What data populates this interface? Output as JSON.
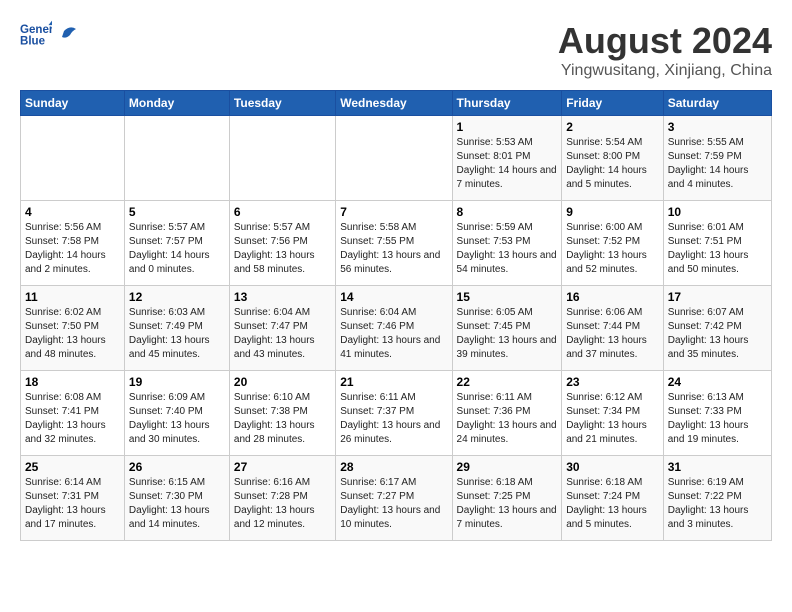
{
  "logo": {
    "line1": "General",
    "line2": "Blue"
  },
  "title": "August 2024",
  "subtitle": "Yingwusitang, Xinjiang, China",
  "days_header": [
    "Sunday",
    "Monday",
    "Tuesday",
    "Wednesday",
    "Thursday",
    "Friday",
    "Saturday"
  ],
  "weeks": [
    [
      {
        "day": "",
        "sunrise": "",
        "sunset": "",
        "daylight": ""
      },
      {
        "day": "",
        "sunrise": "",
        "sunset": "",
        "daylight": ""
      },
      {
        "day": "",
        "sunrise": "",
        "sunset": "",
        "daylight": ""
      },
      {
        "day": "",
        "sunrise": "",
        "sunset": "",
        "daylight": ""
      },
      {
        "day": "1",
        "sunrise": "Sunrise: 5:53 AM",
        "sunset": "Sunset: 8:01 PM",
        "daylight": "Daylight: 14 hours and 7 minutes."
      },
      {
        "day": "2",
        "sunrise": "Sunrise: 5:54 AM",
        "sunset": "Sunset: 8:00 PM",
        "daylight": "Daylight: 14 hours and 5 minutes."
      },
      {
        "day": "3",
        "sunrise": "Sunrise: 5:55 AM",
        "sunset": "Sunset: 7:59 PM",
        "daylight": "Daylight: 14 hours and 4 minutes."
      }
    ],
    [
      {
        "day": "4",
        "sunrise": "Sunrise: 5:56 AM",
        "sunset": "Sunset: 7:58 PM",
        "daylight": "Daylight: 14 hours and 2 minutes."
      },
      {
        "day": "5",
        "sunrise": "Sunrise: 5:57 AM",
        "sunset": "Sunset: 7:57 PM",
        "daylight": "Daylight: 14 hours and 0 minutes."
      },
      {
        "day": "6",
        "sunrise": "Sunrise: 5:57 AM",
        "sunset": "Sunset: 7:56 PM",
        "daylight": "Daylight: 13 hours and 58 minutes."
      },
      {
        "day": "7",
        "sunrise": "Sunrise: 5:58 AM",
        "sunset": "Sunset: 7:55 PM",
        "daylight": "Daylight: 13 hours and 56 minutes."
      },
      {
        "day": "8",
        "sunrise": "Sunrise: 5:59 AM",
        "sunset": "Sunset: 7:53 PM",
        "daylight": "Daylight: 13 hours and 54 minutes."
      },
      {
        "day": "9",
        "sunrise": "Sunrise: 6:00 AM",
        "sunset": "Sunset: 7:52 PM",
        "daylight": "Daylight: 13 hours and 52 minutes."
      },
      {
        "day": "10",
        "sunrise": "Sunrise: 6:01 AM",
        "sunset": "Sunset: 7:51 PM",
        "daylight": "Daylight: 13 hours and 50 minutes."
      }
    ],
    [
      {
        "day": "11",
        "sunrise": "Sunrise: 6:02 AM",
        "sunset": "Sunset: 7:50 PM",
        "daylight": "Daylight: 13 hours and 48 minutes."
      },
      {
        "day": "12",
        "sunrise": "Sunrise: 6:03 AM",
        "sunset": "Sunset: 7:49 PM",
        "daylight": "Daylight: 13 hours and 45 minutes."
      },
      {
        "day": "13",
        "sunrise": "Sunrise: 6:04 AM",
        "sunset": "Sunset: 7:47 PM",
        "daylight": "Daylight: 13 hours and 43 minutes."
      },
      {
        "day": "14",
        "sunrise": "Sunrise: 6:04 AM",
        "sunset": "Sunset: 7:46 PM",
        "daylight": "Daylight: 13 hours and 41 minutes."
      },
      {
        "day": "15",
        "sunrise": "Sunrise: 6:05 AM",
        "sunset": "Sunset: 7:45 PM",
        "daylight": "Daylight: 13 hours and 39 minutes."
      },
      {
        "day": "16",
        "sunrise": "Sunrise: 6:06 AM",
        "sunset": "Sunset: 7:44 PM",
        "daylight": "Daylight: 13 hours and 37 minutes."
      },
      {
        "day": "17",
        "sunrise": "Sunrise: 6:07 AM",
        "sunset": "Sunset: 7:42 PM",
        "daylight": "Daylight: 13 hours and 35 minutes."
      }
    ],
    [
      {
        "day": "18",
        "sunrise": "Sunrise: 6:08 AM",
        "sunset": "Sunset: 7:41 PM",
        "daylight": "Daylight: 13 hours and 32 minutes."
      },
      {
        "day": "19",
        "sunrise": "Sunrise: 6:09 AM",
        "sunset": "Sunset: 7:40 PM",
        "daylight": "Daylight: 13 hours and 30 minutes."
      },
      {
        "day": "20",
        "sunrise": "Sunrise: 6:10 AM",
        "sunset": "Sunset: 7:38 PM",
        "daylight": "Daylight: 13 hours and 28 minutes."
      },
      {
        "day": "21",
        "sunrise": "Sunrise: 6:11 AM",
        "sunset": "Sunset: 7:37 PM",
        "daylight": "Daylight: 13 hours and 26 minutes."
      },
      {
        "day": "22",
        "sunrise": "Sunrise: 6:11 AM",
        "sunset": "Sunset: 7:36 PM",
        "daylight": "Daylight: 13 hours and 24 minutes."
      },
      {
        "day": "23",
        "sunrise": "Sunrise: 6:12 AM",
        "sunset": "Sunset: 7:34 PM",
        "daylight": "Daylight: 13 hours and 21 minutes."
      },
      {
        "day": "24",
        "sunrise": "Sunrise: 6:13 AM",
        "sunset": "Sunset: 7:33 PM",
        "daylight": "Daylight: 13 hours and 19 minutes."
      }
    ],
    [
      {
        "day": "25",
        "sunrise": "Sunrise: 6:14 AM",
        "sunset": "Sunset: 7:31 PM",
        "daylight": "Daylight: 13 hours and 17 minutes."
      },
      {
        "day": "26",
        "sunrise": "Sunrise: 6:15 AM",
        "sunset": "Sunset: 7:30 PM",
        "daylight": "Daylight: 13 hours and 14 minutes."
      },
      {
        "day": "27",
        "sunrise": "Sunrise: 6:16 AM",
        "sunset": "Sunset: 7:28 PM",
        "daylight": "Daylight: 13 hours and 12 minutes."
      },
      {
        "day": "28",
        "sunrise": "Sunrise: 6:17 AM",
        "sunset": "Sunset: 7:27 PM",
        "daylight": "Daylight: 13 hours and 10 minutes."
      },
      {
        "day": "29",
        "sunrise": "Sunrise: 6:18 AM",
        "sunset": "Sunset: 7:25 PM",
        "daylight": "Daylight: 13 hours and 7 minutes."
      },
      {
        "day": "30",
        "sunrise": "Sunrise: 6:18 AM",
        "sunset": "Sunset: 7:24 PM",
        "daylight": "Daylight: 13 hours and 5 minutes."
      },
      {
        "day": "31",
        "sunrise": "Sunrise: 6:19 AM",
        "sunset": "Sunset: 7:22 PM",
        "daylight": "Daylight: 13 hours and 3 minutes."
      }
    ]
  ]
}
